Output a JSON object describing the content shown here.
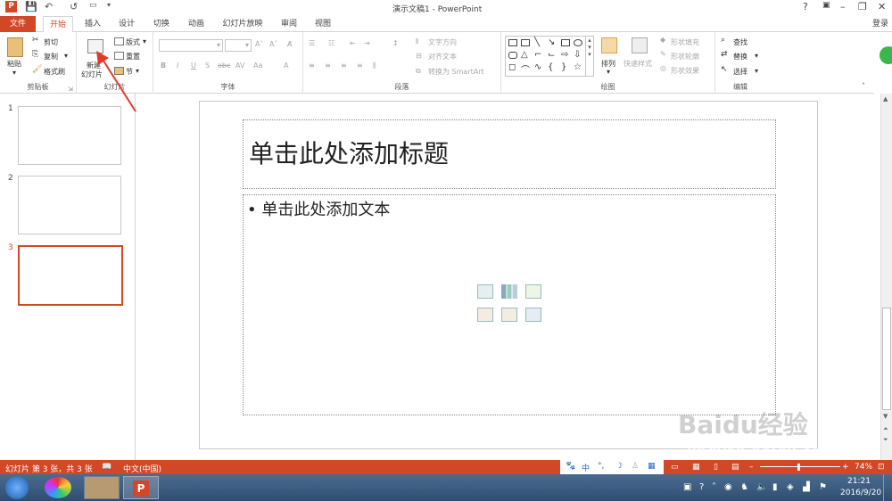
{
  "window": {
    "title": "演示文稿1 - PowerPoint",
    "help": "?",
    "minimize": "–",
    "restore": "❐",
    "close": "✕"
  },
  "quick_access": {
    "save": "💾",
    "undo": "↶",
    "redo": "↺"
  },
  "tabs": [
    {
      "label": "文件"
    },
    {
      "label": "开始"
    },
    {
      "label": "插入"
    },
    {
      "label": "设计"
    },
    {
      "label": "切换"
    },
    {
      "label": "动画"
    },
    {
      "label": "幻灯片放映"
    },
    {
      "label": "审阅"
    },
    {
      "label": "视图"
    }
  ],
  "login": "登录",
  "ribbon": {
    "clipboard": {
      "label": "剪贴板",
      "paste": "粘贴",
      "cut": "剪切",
      "copy": "复制",
      "format_painter": "格式刷"
    },
    "slides": {
      "label": "幻灯片",
      "new_slide": "新建",
      "new_slide_2": "幻灯片",
      "layout": "版式",
      "reset": "重置",
      "section": "节"
    },
    "font": {
      "label": "字体"
    },
    "paragraph": {
      "label": "段落",
      "text_direction": "文字方向",
      "align_text": "对齐文本",
      "smartart": "转换为 SmartArt"
    },
    "drawing": {
      "label": "绘图",
      "arrange": "排列",
      "quick_styles": "快速样式",
      "shape_fill": "形状填充",
      "shape_outline": "形状轮廓",
      "shape_effects": "形状效果"
    },
    "editing": {
      "label": "编辑",
      "find": "查找",
      "replace": "替换",
      "select": "选择"
    }
  },
  "slides": [
    {
      "number": "1"
    },
    {
      "number": "2"
    },
    {
      "number": "3"
    }
  ],
  "slide": {
    "title_placeholder": "单击此处添加标题",
    "body_placeholder": "• 单击此处添加文本"
  },
  "status": {
    "slide_info": "幻灯片 第 3 张，共 3 张",
    "language": "中文(中国)",
    "zoom": "74%"
  },
  "ime": {
    "lang": "中"
  },
  "taskbar": {
    "time": "21:21",
    "date": "2016/9/20"
  },
  "watermark": {
    "text": "Baidu经验",
    "url": "jingyan.baidu.com"
  },
  "colors": {
    "accent": "#d24726",
    "selected_slide_border": "#d24726"
  }
}
